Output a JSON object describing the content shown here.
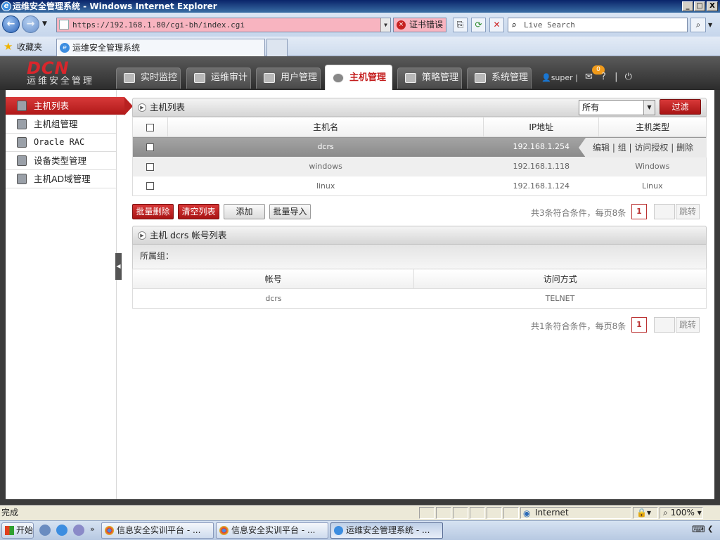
{
  "window": {
    "title": "运维安全管理系统 - Windows Internet Explorer",
    "minimize": "_",
    "maximize": "□",
    "close": "X"
  },
  "browser": {
    "url": "https://192.168.1.80/cgi-bh/index.cgi",
    "cert_error": "证书错误",
    "search_placeholder": "Live Search",
    "favorites_label": "收藏夹",
    "tab_title": "运维安全管理系统"
  },
  "app": {
    "logo_text": "DCN",
    "logo_subtitle": "运维安全管理",
    "nav": [
      {
        "label": "实时监控"
      },
      {
        "label": "运维审计"
      },
      {
        "label": "用户管理"
      },
      {
        "label": "主机管理",
        "active": true
      },
      {
        "label": "策略管理"
      },
      {
        "label": "系统管理"
      }
    ],
    "user": "super",
    "mail_badge": "0",
    "help_icon": "?",
    "logout_icon": "⏻"
  },
  "sidebar": {
    "items": [
      {
        "label": "主机列表",
        "active": true
      },
      {
        "label": "主机组管理"
      },
      {
        "label": "Oracle RAC"
      },
      {
        "label": "设备类型管理"
      },
      {
        "label": "主机AD域管理"
      }
    ]
  },
  "host_list": {
    "title": "主机列表",
    "filter_value": "所有",
    "filter_button": "过滤",
    "columns": [
      "主机名",
      "IP地址",
      "主机类型"
    ],
    "rows": [
      {
        "name": "dcrs",
        "ip": "192.168.1.254",
        "type": "",
        "selected": true
      },
      {
        "name": "windows",
        "ip": "192.168.1.118",
        "type": "Windows"
      },
      {
        "name": "linux",
        "ip": "192.168.1.124",
        "type": "Linux"
      }
    ],
    "row_actions": [
      "编辑",
      "组",
      "访问授权",
      "删除"
    ],
    "buttons": {
      "batch_delete": "批量删除",
      "clear_list": "清空列表",
      "add": "添加",
      "batch_import": "批量导入"
    },
    "pager_text": "共3条符合条件，每页8条",
    "page": "1",
    "jump": "跳转"
  },
  "account_list": {
    "title": "主机 dcrs 帐号列表",
    "group_label": "所属组：",
    "columns": [
      "帐号",
      "访问方式"
    ],
    "rows": [
      {
        "account": "dcrs",
        "method": "TELNET"
      }
    ],
    "pager_text": "共1条符合条件，每页8条",
    "page": "1",
    "jump": "跳转"
  },
  "statusbar": {
    "status": "完成",
    "zone": "Internet",
    "zoom": "100%"
  },
  "taskbar": {
    "start": "开始",
    "tasks": [
      {
        "label": "信息安全实训平台 - ..."
      },
      {
        "label": "信息安全实训平台 - ..."
      },
      {
        "label": "运维安全管理系统 - ...",
        "active": true
      }
    ]
  },
  "colors": {
    "accent_red": "#c41e1e",
    "header_dark": "#3b3b3b",
    "cert_error_bg": "#f8b4c0"
  }
}
